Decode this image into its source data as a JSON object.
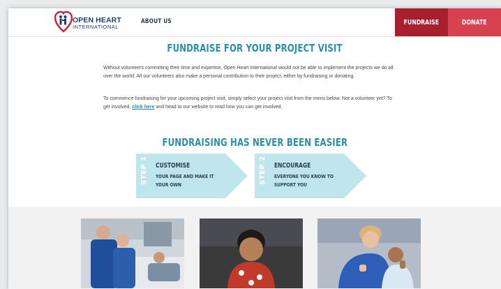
{
  "header": {
    "logo_line1": "OPEN HEART",
    "logo_line2": "INTERNATIONAL",
    "nav_about": "ABOUT US",
    "fundraise_label": "FUNDRAISE",
    "donate_label": "DONATE"
  },
  "main": {
    "title": "FUNDRAISE FOR YOUR PROJECT VISIT",
    "paragraph1": "Without volunteers committing their time and expertise, Open Heart International would not be able to implement the projects we do all over the world. All our volunteers also make a personal contribution to their project, either by fundraising or donating.",
    "paragraph2_before": "To commence fundraising for your upcoming project visit, simply select your project visit from the menu below. Not a volunteer yet? To get involved, ",
    "paragraph2_link": "click here",
    "paragraph2_after": " and head to our website to read how you can get involved.",
    "subtitle": "FUNDRAISING HAS NEVER BEEN EASIER"
  },
  "steps": [
    {
      "number": "STEP 1",
      "title": "CUSTOMISE",
      "description": "YOUR PAGE AND MAKE IT YOUR OWN"
    },
    {
      "number": "STEP 2",
      "title": "ENCOURAGE",
      "description": "EVERYONE YOU KNOW TO SUPPORT YOU"
    }
  ],
  "colors": {
    "brand_navy": "#1f3a70",
    "heading_teal": "#2a8fa8",
    "step_bg": "#bfe6ec",
    "fundraise_red": "#a8202f",
    "donate_red": "#d8414e"
  }
}
